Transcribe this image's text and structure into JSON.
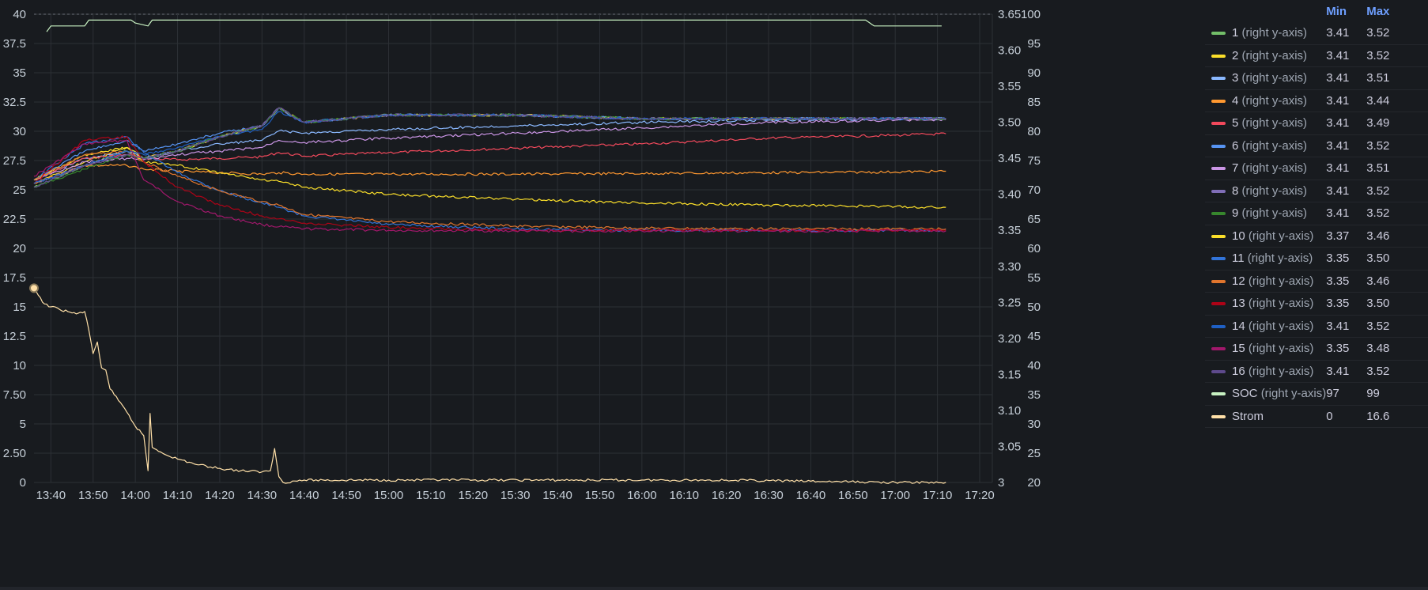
{
  "legend": {
    "col_min": "Min",
    "col_max": "Max",
    "right_axis_suffix": "(right y-axis)",
    "rows": [
      {
        "name": "1",
        "suffix": "(right y-axis)",
        "color": "#73bf69",
        "min": "3.41",
        "max": "3.52"
      },
      {
        "name": "2",
        "suffix": "(right y-axis)",
        "color": "#fade2a",
        "min": "3.41",
        "max": "3.52"
      },
      {
        "name": "3",
        "suffix": "(right y-axis)",
        "color": "#8ab8ff",
        "min": "3.41",
        "max": "3.51"
      },
      {
        "name": "4",
        "suffix": "(right y-axis)",
        "color": "#ff9830",
        "min": "3.41",
        "max": "3.44"
      },
      {
        "name": "5",
        "suffix": "(right y-axis)",
        "color": "#f2495c",
        "min": "3.41",
        "max": "3.49"
      },
      {
        "name": "6",
        "suffix": "(right y-axis)",
        "color": "#5794f2",
        "min": "3.41",
        "max": "3.52"
      },
      {
        "name": "7",
        "suffix": "(right y-axis)",
        "color": "#ca95e5",
        "min": "3.41",
        "max": "3.51"
      },
      {
        "name": "8",
        "suffix": "(right y-axis)",
        "color": "#806eb7",
        "min": "3.41",
        "max": "3.52"
      },
      {
        "name": "9",
        "suffix": "(right y-axis)",
        "color": "#37872d",
        "min": "3.41",
        "max": "3.52"
      },
      {
        "name": "10",
        "suffix": "(right y-axis)",
        "color": "#fade2a",
        "min": "3.37",
        "max": "3.46"
      },
      {
        "name": "11",
        "suffix": "(right y-axis)",
        "color": "#3274d9",
        "min": "3.35",
        "max": "3.50"
      },
      {
        "name": "12",
        "suffix": "(right y-axis)",
        "color": "#e0752d",
        "min": "3.35",
        "max": "3.46"
      },
      {
        "name": "13",
        "suffix": "(right y-axis)",
        "color": "#ad0317",
        "min": "3.35",
        "max": "3.50"
      },
      {
        "name": "14",
        "suffix": "(right y-axis)",
        "color": "#1f60c4",
        "min": "3.41",
        "max": "3.52"
      },
      {
        "name": "15",
        "suffix": "(right y-axis)",
        "color": "#a1186b",
        "min": "3.35",
        "max": "3.48"
      },
      {
        "name": "16",
        "suffix": "(right y-axis)",
        "color": "#5e4a8c",
        "min": "3.41",
        "max": "3.52"
      },
      {
        "name": "SOC",
        "suffix": "(right y-axis)",
        "color": "#c8f2c2",
        "min": "97",
        "max": "99"
      },
      {
        "name": "Strom",
        "suffix": "",
        "color": "#ffe0a8",
        "min": "0",
        "max": "16.6"
      }
    ]
  },
  "chart_data": {
    "type": "line",
    "x_ticks": [
      "13:40",
      "13:50",
      "14:00",
      "14:10",
      "14:20",
      "14:30",
      "14:40",
      "14:50",
      "15:00",
      "15:10",
      "15:20",
      "15:30",
      "15:40",
      "15:50",
      "16:00",
      "16:10",
      "16:20",
      "16:30",
      "16:40",
      "16:50",
      "17:00",
      "17:10",
      "17:20"
    ],
    "x_range": [
      "13:36",
      "17:23"
    ],
    "y_left": {
      "range": [
        0,
        40
      ],
      "ticks": [
        "0",
        "2.50",
        "5",
        "7.50",
        "10",
        "12.5",
        "15",
        "17.5",
        "20",
        "22.5",
        "25",
        "27.5",
        "30",
        "32.5",
        "35",
        "37.5",
        "40"
      ]
    },
    "y_right_voltage": {
      "range": [
        3,
        3.65
      ],
      "ticks": [
        "3",
        "3.05",
        "3.10",
        "3.15",
        "3.20",
        "3.25",
        "3.30",
        "3.35",
        "3.40",
        "3.45",
        "3.50",
        "3.55",
        "3.60",
        "3.65"
      ]
    },
    "y_right_soc": {
      "range": [
        20,
        100
      ],
      "ticks": [
        "20",
        "25",
        "30",
        "35",
        "40",
        "45",
        "50",
        "55",
        "60",
        "65",
        "70",
        "75",
        "80",
        "85",
        "90",
        "95",
        "100"
      ]
    },
    "grid": true,
    "legend_position": "right",
    "series": [
      {
        "name": "1",
        "axis": "voltage",
        "color": "#73bf69",
        "x": [
          "13:36",
          "13:48",
          "13:58",
          "14:02",
          "14:10",
          "14:20",
          "14:30",
          "14:34",
          "14:40",
          "15:00",
          "15:30",
          "16:00",
          "16:30",
          "17:00",
          "17:12"
        ],
        "y": [
          3.41,
          3.44,
          3.46,
          3.45,
          3.46,
          3.48,
          3.495,
          3.52,
          3.5,
          3.51,
          3.51,
          3.505,
          3.505,
          3.505,
          3.505
        ]
      },
      {
        "name": "2",
        "axis": "voltage",
        "color": "#fade2a",
        "x": [
          "13:36",
          "13:48",
          "13:58",
          "14:02",
          "14:10",
          "14:20",
          "14:30",
          "14:34",
          "14:40",
          "15:00",
          "15:30",
          "16:00",
          "16:30",
          "17:00",
          "17:12"
        ],
        "y": [
          3.415,
          3.445,
          3.465,
          3.45,
          3.46,
          3.48,
          3.495,
          3.52,
          3.5,
          3.51,
          3.51,
          3.505,
          3.505,
          3.505,
          3.505
        ]
      },
      {
        "name": "3",
        "axis": "voltage",
        "color": "#8ab8ff",
        "x": [
          "13:36",
          "13:48",
          "13:58",
          "14:02",
          "14:10",
          "14:20",
          "14:30",
          "14:34",
          "14:40",
          "15:00",
          "15:30",
          "16:00",
          "16:30",
          "17:00",
          "17:12"
        ],
        "y": [
          3.42,
          3.45,
          3.46,
          3.45,
          3.46,
          3.47,
          3.475,
          3.488,
          3.485,
          3.49,
          3.495,
          3.5,
          3.503,
          3.505,
          3.505
        ]
      },
      {
        "name": "4",
        "axis": "voltage",
        "color": "#ff9830",
        "x": [
          "13:36",
          "13:48",
          "13:58",
          "14:02",
          "14:10",
          "14:20",
          "14:30",
          "14:34",
          "14:40",
          "15:00",
          "15:30",
          "16:00",
          "16:30",
          "17:00",
          "17:12"
        ],
        "y": [
          3.415,
          3.44,
          3.44,
          3.435,
          3.432,
          3.43,
          3.428,
          3.43,
          3.428,
          3.428,
          3.428,
          3.429,
          3.43,
          3.431,
          3.432
        ]
      },
      {
        "name": "5",
        "axis": "voltage",
        "color": "#f2495c",
        "x": [
          "13:36",
          "13:48",
          "13:58",
          "14:02",
          "14:10",
          "14:20",
          "14:30",
          "14:34",
          "14:40",
          "15:00",
          "15:30",
          "16:00",
          "16:30",
          "17:00",
          "17:12"
        ],
        "y": [
          3.42,
          3.45,
          3.455,
          3.45,
          3.448,
          3.45,
          3.452,
          3.458,
          3.453,
          3.458,
          3.464,
          3.47,
          3.478,
          3.482,
          3.484
        ]
      },
      {
        "name": "6",
        "axis": "voltage",
        "color": "#5794f2",
        "x": [
          "13:36",
          "13:48",
          "13:58",
          "14:02",
          "14:10",
          "14:20",
          "14:30",
          "14:34",
          "14:40",
          "15:00",
          "15:30",
          "16:00",
          "16:30",
          "17:00",
          "17:12"
        ],
        "y": [
          3.42,
          3.46,
          3.475,
          3.46,
          3.47,
          3.485,
          3.495,
          3.52,
          3.5,
          3.51,
          3.51,
          3.505,
          3.505,
          3.505,
          3.505
        ]
      },
      {
        "name": "7",
        "axis": "voltage",
        "color": "#ca95e5",
        "x": [
          "13:36",
          "13:48",
          "13:58",
          "14:02",
          "14:10",
          "14:20",
          "14:30",
          "14:34",
          "14:40",
          "15:00",
          "15:30",
          "16:00",
          "16:30",
          "17:00",
          "17:12"
        ],
        "y": [
          3.42,
          3.445,
          3.45,
          3.448,
          3.455,
          3.46,
          3.465,
          3.475,
          3.472,
          3.478,
          3.485,
          3.492,
          3.5,
          3.503,
          3.504
        ]
      },
      {
        "name": "8",
        "axis": "voltage",
        "color": "#806eb7",
        "x": [
          "13:36",
          "13:48",
          "13:58",
          "14:02",
          "14:10",
          "14:20",
          "14:30",
          "14:34",
          "14:40",
          "15:00",
          "15:30",
          "16:00",
          "16:30",
          "17:00",
          "17:12"
        ],
        "y": [
          3.415,
          3.44,
          3.455,
          3.45,
          3.46,
          3.48,
          3.495,
          3.52,
          3.5,
          3.51,
          3.51,
          3.505,
          3.505,
          3.505,
          3.505
        ]
      },
      {
        "name": "9",
        "axis": "voltage",
        "color": "#37872d",
        "x": [
          "13:36",
          "13:48",
          "13:58",
          "14:02",
          "14:10",
          "14:20",
          "14:30",
          "14:34",
          "14:40",
          "15:00",
          "15:30",
          "16:00",
          "16:30",
          "17:00",
          "17:12"
        ],
        "y": [
          3.41,
          3.435,
          3.455,
          3.45,
          3.46,
          3.48,
          3.495,
          3.52,
          3.5,
          3.51,
          3.51,
          3.505,
          3.505,
          3.505,
          3.505
        ]
      },
      {
        "name": "10",
        "axis": "voltage",
        "color": "#fade2a",
        "x": [
          "13:36",
          "13:48",
          "13:58",
          "14:02",
          "14:10",
          "14:20",
          "14:30",
          "14:34",
          "14:40",
          "15:00",
          "15:30",
          "16:00",
          "16:30",
          "17:00",
          "17:12"
        ],
        "y": [
          3.42,
          3.455,
          3.465,
          3.445,
          3.44,
          3.43,
          3.42,
          3.418,
          3.41,
          3.4,
          3.393,
          3.388,
          3.385,
          3.383,
          3.382
        ]
      },
      {
        "name": "11",
        "axis": "voltage",
        "color": "#3274d9",
        "x": [
          "13:36",
          "13:48",
          "13:58",
          "14:02",
          "14:10",
          "14:20",
          "14:30",
          "14:34",
          "14:40",
          "15:00",
          "15:30",
          "16:00",
          "16:30",
          "17:00",
          "17:12"
        ],
        "y": [
          3.42,
          3.47,
          3.48,
          3.458,
          3.43,
          3.405,
          3.388,
          3.382,
          3.37,
          3.358,
          3.352,
          3.35,
          3.35,
          3.35,
          3.35
        ]
      },
      {
        "name": "12",
        "axis": "voltage",
        "color": "#e0752d",
        "x": [
          "13:36",
          "13:48",
          "13:58",
          "14:02",
          "14:10",
          "14:20",
          "14:30",
          "14:34",
          "14:40",
          "15:00",
          "15:30",
          "16:00",
          "16:30",
          "17:00",
          "17:12"
        ],
        "y": [
          3.42,
          3.455,
          3.46,
          3.445,
          3.425,
          3.405,
          3.39,
          3.385,
          3.372,
          3.362,
          3.356,
          3.353,
          3.352,
          3.352,
          3.352
        ]
      },
      {
        "name": "13",
        "axis": "voltage",
        "color": "#ad0317",
        "x": [
          "13:36",
          "13:48",
          "13:58",
          "14:02",
          "14:10",
          "14:20",
          "14:30",
          "14:34",
          "14:40",
          "15:00",
          "15:30",
          "16:00",
          "16:30",
          "17:00",
          "17:12"
        ],
        "y": [
          3.415,
          3.475,
          3.48,
          3.445,
          3.41,
          3.385,
          3.37,
          3.366,
          3.36,
          3.354,
          3.35,
          3.35,
          3.35,
          3.35,
          3.35
        ]
      },
      {
        "name": "14",
        "axis": "voltage",
        "color": "#1f60c4",
        "x": [
          "13:36",
          "13:48",
          "13:58",
          "14:02",
          "14:10",
          "14:20",
          "14:30",
          "14:34",
          "14:40",
          "15:00",
          "15:30",
          "16:00",
          "16:30",
          "17:00",
          "17:12"
        ],
        "y": [
          3.415,
          3.44,
          3.46,
          3.455,
          3.465,
          3.48,
          3.49,
          3.515,
          3.5,
          3.51,
          3.51,
          3.505,
          3.505,
          3.505,
          3.505
        ]
      },
      {
        "name": "15",
        "axis": "voltage",
        "color": "#a1186b",
        "x": [
          "13:36",
          "13:48",
          "13:58",
          "14:02",
          "14:10",
          "14:20",
          "14:30",
          "14:34",
          "14:40",
          "15:00",
          "15:30",
          "16:00",
          "16:30",
          "17:00",
          "17:12"
        ],
        "y": [
          3.425,
          3.47,
          3.475,
          3.42,
          3.39,
          3.37,
          3.358,
          3.355,
          3.352,
          3.35,
          3.349,
          3.349,
          3.349,
          3.349,
          3.349
        ]
      },
      {
        "name": "16",
        "axis": "voltage",
        "color": "#5e4a8c",
        "x": [
          "13:36",
          "13:48",
          "13:58",
          "14:02",
          "14:10",
          "14:20",
          "14:30",
          "14:34",
          "14:40",
          "15:00",
          "15:30",
          "16:00",
          "16:30",
          "17:00",
          "17:12"
        ],
        "y": [
          3.41,
          3.44,
          3.455,
          3.45,
          3.46,
          3.48,
          3.495,
          3.52,
          3.5,
          3.51,
          3.51,
          3.505,
          3.505,
          3.505,
          3.505
        ]
      },
      {
        "name": "SOC",
        "axis": "soc",
        "color": "#c8f2c2",
        "x": [
          "13:39",
          "13:40",
          "13:48",
          "13:49",
          "13:59",
          "14:00",
          "14:03",
          "14:04",
          "16:53",
          "16:55",
          "17:11"
        ],
        "y": [
          97,
          98,
          98,
          99,
          99,
          98.5,
          98,
          99,
          99,
          98,
          98
        ]
      },
      {
        "name": "Strom",
        "axis": "left",
        "color": "#ffe0a8",
        "x": [
          "13:36",
          "13:38",
          "13:40",
          "13:42",
          "13:44",
          "13:46",
          "13:48",
          "13:49",
          "13:50",
          "13:51",
          "13:52",
          "13:53",
          "13:54",
          "13:55",
          "13:56",
          "13:58",
          "14:00",
          "14:02",
          "14:03",
          "14:03.5",
          "14:04",
          "14:06",
          "14:10",
          "14:15",
          "14:20",
          "14:25",
          "14:30",
          "14:32",
          "14:33",
          "14:34",
          "14:35",
          "14:40",
          "15:00",
          "15:20",
          "15:40",
          "16:00",
          "16:20",
          "16:40",
          "17:00",
          "17:12"
        ],
        "y": [
          16.6,
          15.4,
          15.0,
          14.8,
          14.6,
          14.4,
          14.6,
          13.0,
          11.0,
          12.0,
          9.8,
          9.6,
          8.0,
          7.5,
          7.0,
          6.0,
          4.8,
          4.0,
          1.0,
          5.9,
          3.0,
          2.6,
          2.0,
          1.5,
          1.2,
          1.0,
          0.9,
          1.0,
          2.9,
          0.5,
          0.0,
          0.2,
          0.2,
          0.2,
          0.2,
          0.2,
          0.2,
          0.1,
          0.0,
          0.0
        ]
      }
    ]
  }
}
